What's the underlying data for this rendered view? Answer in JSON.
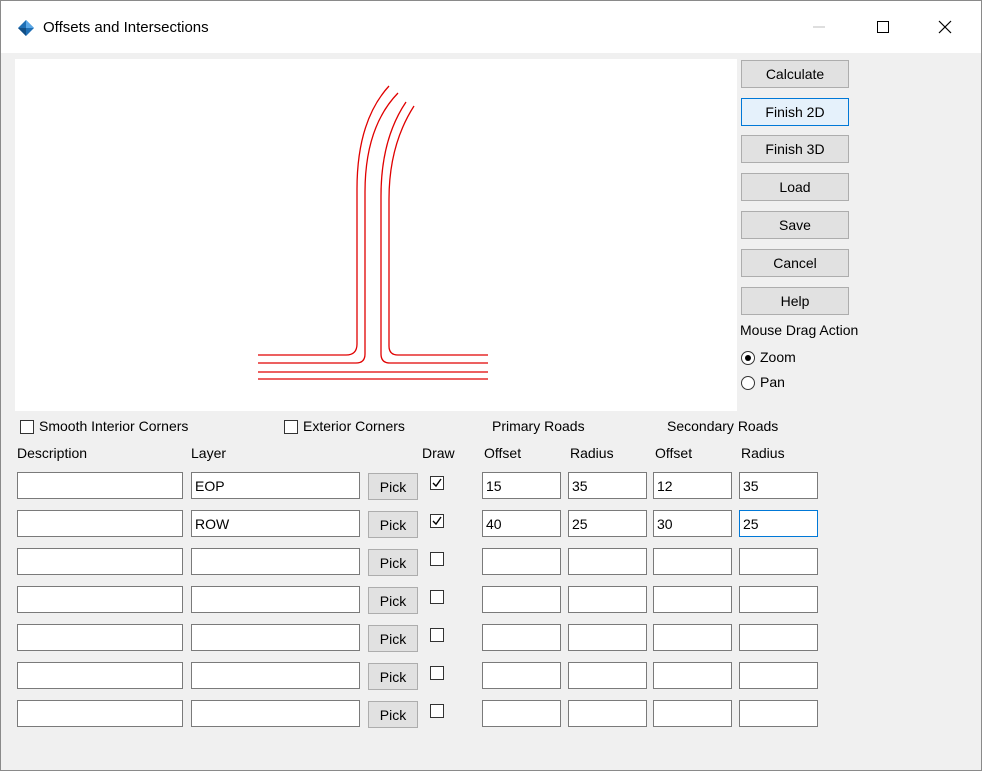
{
  "window": {
    "title": "Offsets and Intersections",
    "minimize_icon": "minimize-icon",
    "maximize_icon": "maximize-icon",
    "close_icon": "close-icon",
    "app_icon": "civil-app-icon",
    "line_color": "#e00000",
    "focus_color": "#0078d7"
  },
  "buttons": {
    "calculate": "Calculate",
    "finish2d": "Finish 2D",
    "finish3d": "Finish 3D",
    "load": "Load",
    "save": "Save",
    "cancel": "Cancel",
    "help": "Help"
  },
  "mouse_drag": {
    "label": "Mouse Drag Action",
    "options": [
      "Zoom",
      "Pan"
    ],
    "selected": "Zoom"
  },
  "options": {
    "smooth_interior_corners": {
      "label": "Smooth Interior Corners",
      "checked": false
    },
    "exterior_corners": {
      "label": "Exterior Corners",
      "checked": false
    }
  },
  "groups": {
    "primary": "Primary Roads",
    "secondary": "Secondary Roads"
  },
  "columns": {
    "description": "Description",
    "layer": "Layer",
    "draw": "Draw",
    "offset": "Offset",
    "radius": "Radius",
    "offset2": "Offset",
    "radius2": "Radius"
  },
  "pick_label": "Pick",
  "rows": [
    {
      "description": "",
      "layer": "EOP",
      "draw": true,
      "p_offset": "15",
      "p_radius": "35",
      "s_offset": "12",
      "s_radius": "35"
    },
    {
      "description": "",
      "layer": "ROW",
      "draw": true,
      "p_offset": "40",
      "p_radius": "25",
      "s_offset": "30",
      "s_radius": "25"
    },
    {
      "description": "",
      "layer": "",
      "draw": false,
      "p_offset": "",
      "p_radius": "",
      "s_offset": "",
      "s_radius": ""
    },
    {
      "description": "",
      "layer": "",
      "draw": false,
      "p_offset": "",
      "p_radius": "",
      "s_offset": "",
      "s_radius": ""
    },
    {
      "description": "",
      "layer": "",
      "draw": false,
      "p_offset": "",
      "p_radius": "",
      "s_offset": "",
      "s_radius": ""
    },
    {
      "description": "",
      "layer": "",
      "draw": false,
      "p_offset": "",
      "p_radius": "",
      "s_offset": "",
      "s_radius": ""
    },
    {
      "description": "",
      "layer": "",
      "draw": false,
      "p_offset": "",
      "p_radius": "",
      "s_offset": "",
      "s_radius": ""
    }
  ]
}
